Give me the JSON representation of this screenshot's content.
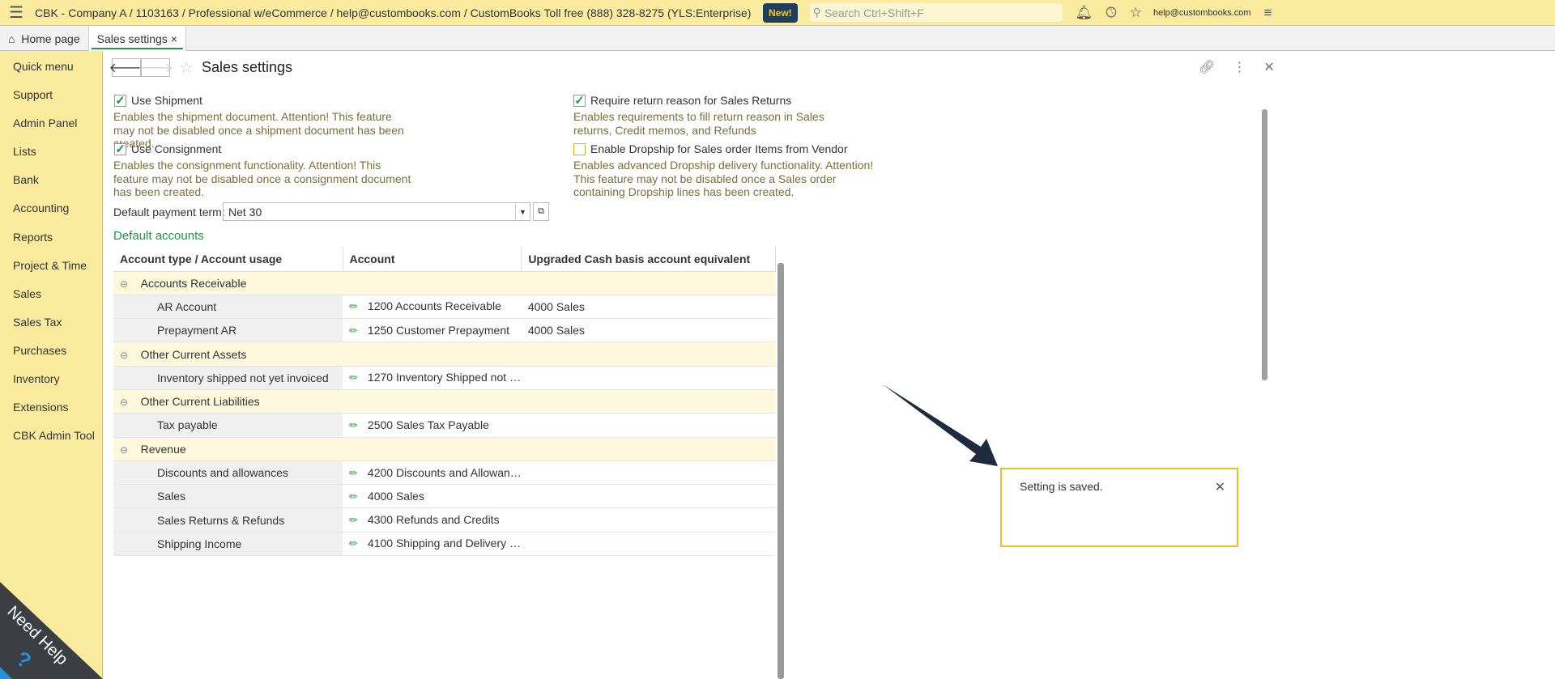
{
  "topbar": {
    "title": "CBK - Company A / 1103163 / Professional w/eCommerce / help@custombooks.com / CustomBooks Toll free (888) 328-8275  (YLS:Enterprise)",
    "new_label": "New!",
    "search_placeholder": "Search Ctrl+Shift+F",
    "user": "help@custombooks.com"
  },
  "tabs": [
    {
      "label": "Home page"
    },
    {
      "label": "Sales settings",
      "close": "×"
    }
  ],
  "sidebar": {
    "items": [
      "Quick menu",
      "Support",
      "Admin Panel",
      "Lists",
      "Bank",
      "Accounting",
      "Reports",
      "Project & Time",
      "Sales",
      "Sales Tax",
      "Purchases",
      "Inventory",
      "Extensions",
      "CBK Admin Tool"
    ],
    "help_label": "Need Help"
  },
  "page": {
    "title": "Sales settings",
    "options": [
      {
        "label": "Use Shipment",
        "checked": true,
        "desc": "Enables the shipment document.  Attention!  This feature may not be disabled once a shipment document has been created."
      },
      {
        "label": "Use Consignment",
        "checked": true,
        "desc": "Enables the consignment functionality.  Attention!  This feature may not be disabled once a consignment document has been created."
      },
      {
        "label": "Require return reason for Sales Returns",
        "checked": true,
        "desc": "Enables requirements to fill return reason in Sales returns, Credit memos, and Refunds"
      },
      {
        "label": "Enable Dropship for Sales order Items from Vendor",
        "checked": false,
        "desc": "Enables advanced Dropship delivery functionality. Attention! This feature may not be disabled once a Sales order containing Dropship lines has been created."
      }
    ],
    "payment_term_label": "Default payment term:",
    "payment_term_value": "Net 30",
    "section_title": "Default accounts",
    "columns": [
      "Account type / Account usage",
      "Account",
      "Upgraded Cash basis account equivalent"
    ],
    "rows": [
      {
        "group": "Accounts Receivable"
      },
      {
        "type": "AR Account",
        "account": "1200 Accounts Receivable",
        "cash": "4000 Sales"
      },
      {
        "type": "Prepayment AR",
        "account": "1250 Customer Prepayment",
        "cash": "4000 Sales"
      },
      {
        "group": "Other Current Assets"
      },
      {
        "type": "Inventory shipped not yet invoiced",
        "account": "1270 Inventory Shipped not …",
        "cash": ""
      },
      {
        "group": "Other Current Liabilities"
      },
      {
        "type": "Tax payable",
        "account": "2500 Sales Tax Payable",
        "cash": ""
      },
      {
        "group": "Revenue"
      },
      {
        "type": "Discounts and allowances",
        "account": "4200 Discounts and Allowan…",
        "cash": ""
      },
      {
        "type": "Sales",
        "account": "4000 Sales",
        "cash": ""
      },
      {
        "type": "Sales Returns & Refunds",
        "account": "4300 Refunds and Credits",
        "cash": ""
      },
      {
        "type": "Shipping Income",
        "account": "4100 Shipping and Delivery …",
        "cash": ""
      }
    ]
  },
  "toast": {
    "message": "Setting is saved."
  }
}
